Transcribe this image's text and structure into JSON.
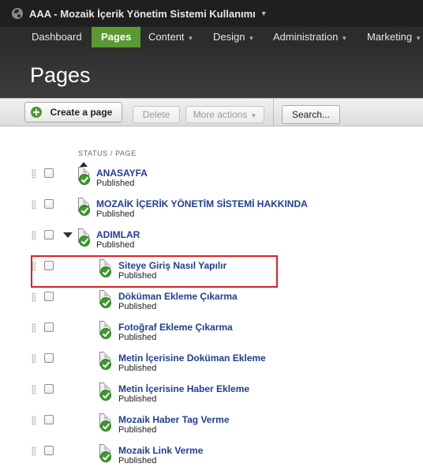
{
  "topbar": {
    "site_title": "AAA - Mozaik İçerik Yönetim Sistemi Kullanımı"
  },
  "nav": {
    "items": [
      {
        "label": "Dashboard",
        "active": false,
        "dropdown": false
      },
      {
        "label": "Pages",
        "active": true,
        "dropdown": false
      },
      {
        "label": "Content",
        "active": false,
        "dropdown": true
      },
      {
        "label": "Design",
        "active": false,
        "dropdown": true
      },
      {
        "label": "Administration",
        "active": false,
        "dropdown": true
      },
      {
        "label": "Marketing",
        "active": false,
        "dropdown": true
      }
    ]
  },
  "header": {
    "title": "Pages"
  },
  "toolbar": {
    "create_label": "Create a page",
    "delete_label": "Delete",
    "more_label": "More actions",
    "search_label": "Search..."
  },
  "list": {
    "header": "STATUS / PAGE",
    "rows": [
      {
        "name": "ANASAYFA",
        "status": "Published",
        "level": 0,
        "home": true
      },
      {
        "name": "MOZAİK İÇERİK YÖNETİM SİSTEMİ HAKKINDA",
        "status": "Published",
        "level": 0
      },
      {
        "name": "ADIMLAR",
        "status": "Published",
        "level": 0,
        "expanded": true
      },
      {
        "name": "Siteye Giriş Nasıl Yapılır",
        "status": "Published",
        "level": 1,
        "highlighted": true
      },
      {
        "name": "Döküman Ekleme Çıkarma",
        "status": "Published",
        "level": 1
      },
      {
        "name": "Fotoğraf Ekleme Çıkarma",
        "status": "Published",
        "level": 1
      },
      {
        "name": "Metin İçerisine Doküman Ekleme",
        "status": "Published",
        "level": 1
      },
      {
        "name": "Metin İçerisine Haber Ekleme",
        "status": "Published",
        "level": 1
      },
      {
        "name": "Mozaik Haber Tag Verme",
        "status": "Published",
        "level": 1
      },
      {
        "name": "Mozaik Link Verme",
        "status": "Published",
        "level": 1
      }
    ]
  },
  "colors": {
    "nav_active": "#5a9a33",
    "link": "#1f3f97",
    "published_check": "#3c9a2b",
    "highlight_border": "#e02020"
  }
}
